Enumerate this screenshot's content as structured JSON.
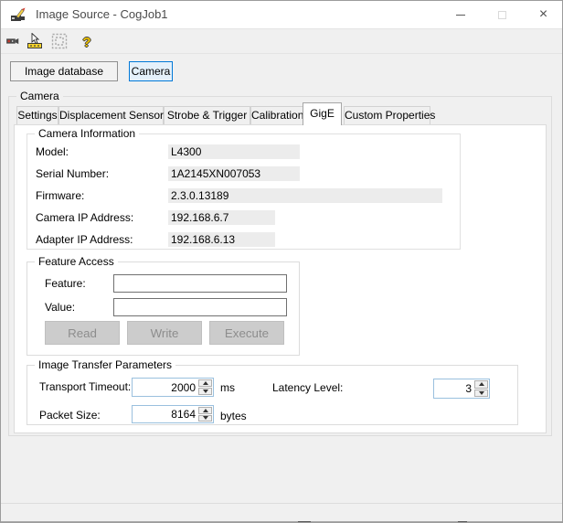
{
  "window": {
    "title": "Image Source - CogJob1",
    "close_glyph": "×"
  },
  "toolbar": {
    "help_glyph": "?",
    "icons": [
      "camera",
      "setup-measure",
      "image-region-disabled",
      "help"
    ]
  },
  "source_buttons": {
    "image_database": "Image database",
    "camera": "Camera"
  },
  "camera_group": {
    "label": "Camera",
    "tabs": [
      "Settings",
      "Displacement Sensor",
      "Strobe & Trigger",
      "Calibration",
      "GigE",
      "Custom Properties"
    ],
    "selected_tab": "GigE"
  },
  "camera_information": {
    "label": "Camera Information",
    "fields": [
      {
        "label": "Model:",
        "value": "L4300"
      },
      {
        "label": "Serial Number:",
        "value": "1A2145XN007053"
      },
      {
        "label": "Firmware:",
        "value": "2.3.0.13189"
      },
      {
        "label": "Camera IP Address:",
        "value": "192.168.6.7"
      },
      {
        "label": "Adapter IP Address:",
        "value": "192.168.6.13"
      }
    ]
  },
  "feature_access": {
    "label": "Feature Access",
    "feature_label": "Feature:",
    "feature_value": "",
    "value_label": "Value:",
    "value_value": "",
    "read_button": "Read",
    "write_button": "Write",
    "execute_button": "Execute"
  },
  "image_transfer": {
    "label": "Image Transfer Parameters",
    "transport_timeout_label": "Transport Timeout:",
    "transport_timeout_value": "2000",
    "transport_timeout_unit": "ms",
    "latency_level_label": "Latency Level:",
    "latency_level_value": "3",
    "packet_size_label": "Packet Size:",
    "packet_size_value": "8164",
    "packet_size_unit": "bytes"
  },
  "colors": {
    "dialog_bg": "#f0f0f0",
    "page_bg": "#ffffff",
    "selected_button_border": "#0078d7",
    "selected_button_bg": "#e5f1fb",
    "readonly_field_bg": "#ececec",
    "disabled_button_bg": "#cccccc",
    "disabled_button_text": "#8d8d8d"
  }
}
